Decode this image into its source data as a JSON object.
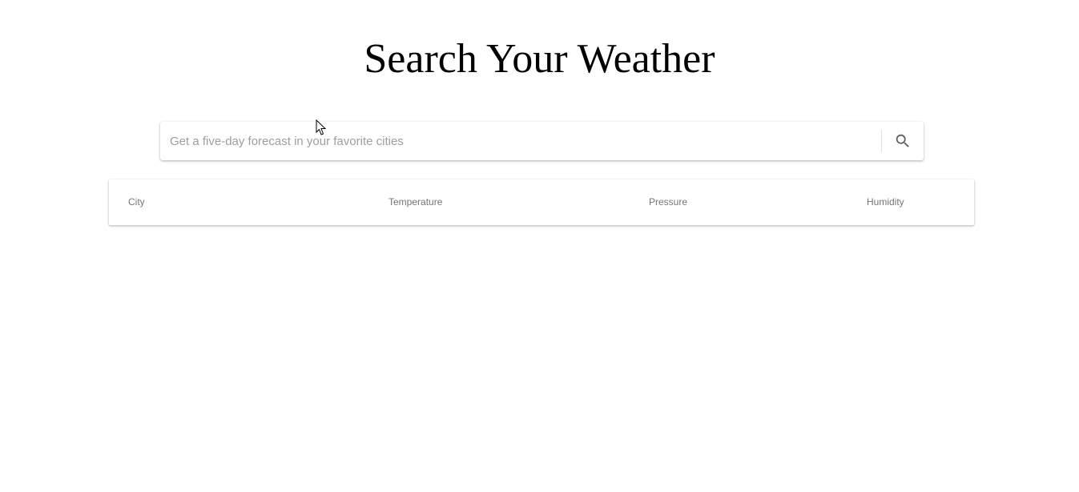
{
  "page": {
    "title": "Search Your Weather"
  },
  "search": {
    "placeholder": "Get a five-day forecast in your favorite cities",
    "value": "",
    "button_icon": "search-icon"
  },
  "table": {
    "columns": [
      "City",
      "Temperature",
      "Pressure",
      "Humidity"
    ],
    "rows": []
  },
  "colors": {
    "background": "#ffffff",
    "title_text": "#000000",
    "placeholder_text": "#9e9e9e",
    "header_text": "#757575",
    "icon": "#616161"
  }
}
